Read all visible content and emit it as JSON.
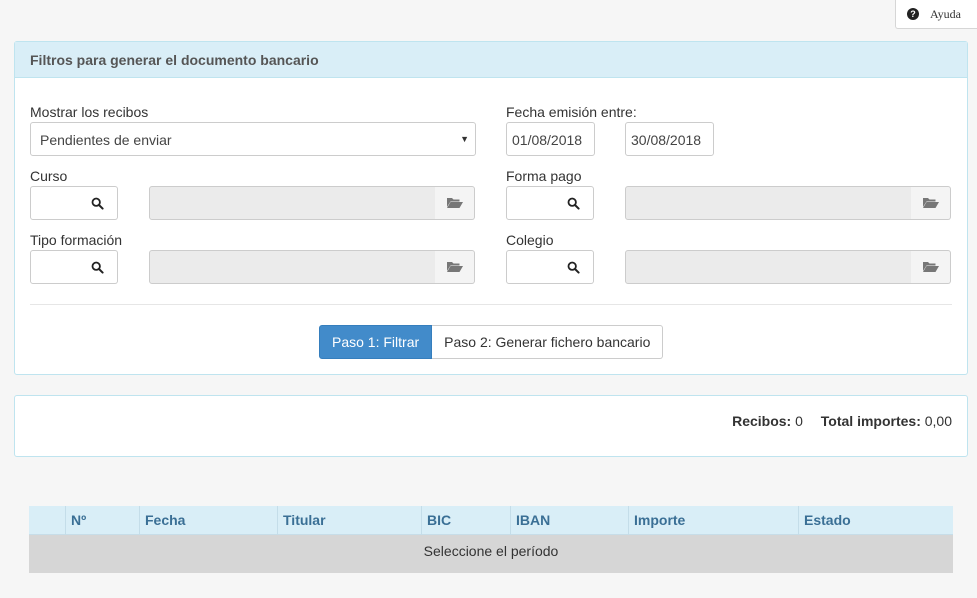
{
  "help": {
    "label": "Ayuda",
    "icon": "question-circle-icon"
  },
  "filters": {
    "title": "Filtros para generar el documento bancario",
    "mostrar": {
      "label": "Mostrar los recibos",
      "selected": "Pendientes de enviar"
    },
    "fecha": {
      "label": "Fecha emisión entre:",
      "from": "01/08/2018",
      "to": "30/08/2018"
    },
    "curso": {
      "label": "Curso",
      "code": "",
      "description": ""
    },
    "forma_pago": {
      "label": "Forma pago",
      "code": "",
      "description": ""
    },
    "tipo_formacion": {
      "label": "Tipo formación",
      "code": "",
      "description": ""
    },
    "colegio": {
      "label": "Colegio",
      "code": "",
      "description": ""
    },
    "buttons": {
      "step1": "Paso 1: Filtrar",
      "step2": "Paso 2: Generar fichero bancario"
    },
    "colors": {
      "primary": "#428bca",
      "heading_bg": "#d9eef7"
    }
  },
  "summary": {
    "recibos_label": "Recibos:",
    "recibos_value": "0",
    "total_label": "Total importes:",
    "total_value": "0,00"
  },
  "table": {
    "columns": [
      "",
      "Nº",
      "Fecha",
      "Titular",
      "BIC",
      "IBAN",
      "Importe",
      "Estado"
    ],
    "empty_message": "Seleccione el período"
  }
}
